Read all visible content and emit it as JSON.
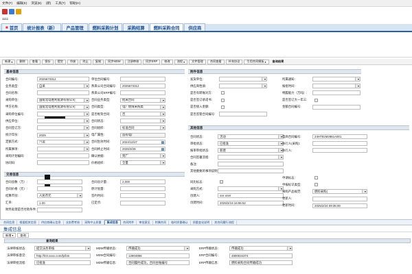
{
  "menu": [
    "文件(F)",
    "编辑(E)",
    "浏览(B)",
    "(新)",
    "工具(T)",
    "帮助(H)"
  ],
  "status_text": "1111",
  "tabs": [
    "首页",
    "统计报表（新）",
    "产品管理",
    "燃料采购计划",
    "采购结算",
    "燃料采购合同",
    "供应商"
  ],
  "toolbar": {
    "items": [
      "新建",
      "删除",
      "查看",
      "保存",
      "提交",
      "作废",
      "终止",
      "复制",
      "同步MDM",
      "注册审核",
      "同步ERP",
      "修改",
      "流程",
      "文件管理",
      "合同查看",
      "补充协议",
      "引用合同模板",
      "查询结果"
    ],
    "bold_label": "查询结果"
  },
  "basic": {
    "title": "基本信息",
    "left_labels": [
      "合同编号:",
      "业务类型:",
      "合同名称:",
      "采购单位:",
      "甲方名称:",
      "采购单位编号:",
      "供应单位:",
      "合同签订方:",
      "统计年份:",
      "定额方式:",
      "所属事项:",
      "采购计划编码:",
      "协同码:"
    ],
    "left_values": [
      "2025673312",
      "自采",
      "",
      "国能北电胜利能源有限公司",
      "国能北电胜利能源有限公司",
      "",
      "",
      "",
      "2025",
      "汽运",
      "",
      "",
      ""
    ],
    "mid_labels": [
      "单位合同编号:",
      "燕来公司合同编号:",
      "燕来公司ERP编号:",
      "合同业务类型:",
      "合同类型:",
      "是否框架合同:",
      "合同状态:",
      "合同组织:",
      "电厂属性:",
      "合同生效时间:",
      "合同终止时间:",
      "确认依据:",
      "价格组织:"
    ],
    "mid_values": [
      "",
      "2025673312",
      "",
      "批采合同",
      "电厂燃煤采购类",
      "否",
      "",
      "标准合同",
      "首有电厂",
      "2024/12/27",
      "2025/3/28",
      "到厂",
      "全量"
    ],
    "right_labels": [
      "发货单位:",
      "供应商性质:",
      "是否有转账对方:",
      "是否签订承诺书:",
      "是否接入金额:",
      "是否监管合同编号:"
    ],
    "right_labels2": [
      "所属通知:",
      "报批时间:",
      "特履能力（万吨）:",
      "是否签订大一年三:",
      "金额合同编号:"
    ]
  },
  "other": {
    "title": "其他信息",
    "labels_left": [
      "合同状态:",
      "审批状态:",
      "报审审批状态:",
      "合同签署流程:",
      "备注:",
      "其他重要的事项说明:"
    ],
    "values_left": [
      "活动",
      "已批准",
      "新建",
      "",
      "",
      ""
    ],
    "labels_right": [
      "电商合同编号:",
      "执行人(采购):",
      "执行人:"
    ],
    "values_right": [
      "24HT81M2861A001",
      "",
      ""
    ]
  },
  "trade": {
    "title": "交易信息",
    "labels_left": [
      "合同总数（万）:",
      "合同价格（元）:",
      "结算币别:",
      "汇率:",
      "财务处理是否付款条件:"
    ],
    "values_left": [
      "",
      "",
      "人民币元",
      "1.00",
      ""
    ],
    "labels_mid": [
      "合同总计量:",
      "原计划量:",
      "签约时间:",
      "已定点:"
    ],
    "values_mid": [
      "2,000",
      "",
      "",
      ""
    ],
    "labels_right": [
      "同比标志:",
      "采购方式:",
      "创建人:",
      "创建时间:"
    ],
    "values_right": [
      "",
      "",
      "xxx user",
      "2025/2/19 16:55:52"
    ],
    "labels_right2": [
      "申请标志:",
      "申报标识类型:",
      "采购产品规范:",
      "更新人:",
      "更新时间:"
    ],
    "values_right2": [
      "",
      "",
      "燃料采购(",
      "",
      "2025/2/24 09:35:00"
    ]
  },
  "subtabs": [
    "合同信息",
    "根据相关信息",
    "供应商确认信息",
    "业务费考核",
    "采购中止质量",
    "集成信息",
    "合同附件",
    "审批意见",
    "附属合同",
    "临时质量确认",
    "质量变化说明",
    "其合同履行流程"
  ],
  "integ": {
    "title": "集成信息",
    "btn_new": "新增",
    "btn_query": "查询",
    "grid_title": "查询结果",
    "col1_labels": [
      "法律审核状态:",
      "法律审核意见:",
      "法律审批流程:"
    ],
    "col1_values": [
      "提交法务审核",
      "http://ln3.xxxx.com/lp/bm",
      "已批准"
    ],
    "col2_labels": [
      "MDM传输状态:",
      "MDM合同编号:",
      "MDM传输信息:"
    ],
    "col2_values": [
      "传输成功",
      "12904896",
      "合同履约成功，合同台账编号"
    ],
    "col3_labels": [
      "ERP传输状态:",
      "ERP合同编号:",
      "ERP传输信息:"
    ],
    "col3_values": [
      "传输成功",
      "4800034374",
      "燃料采购合同传输成功"
    ],
    "col2_extra": "胜电电力（2025）18号",
    "col3_extra": "2025/2/24 09:35:00"
  }
}
